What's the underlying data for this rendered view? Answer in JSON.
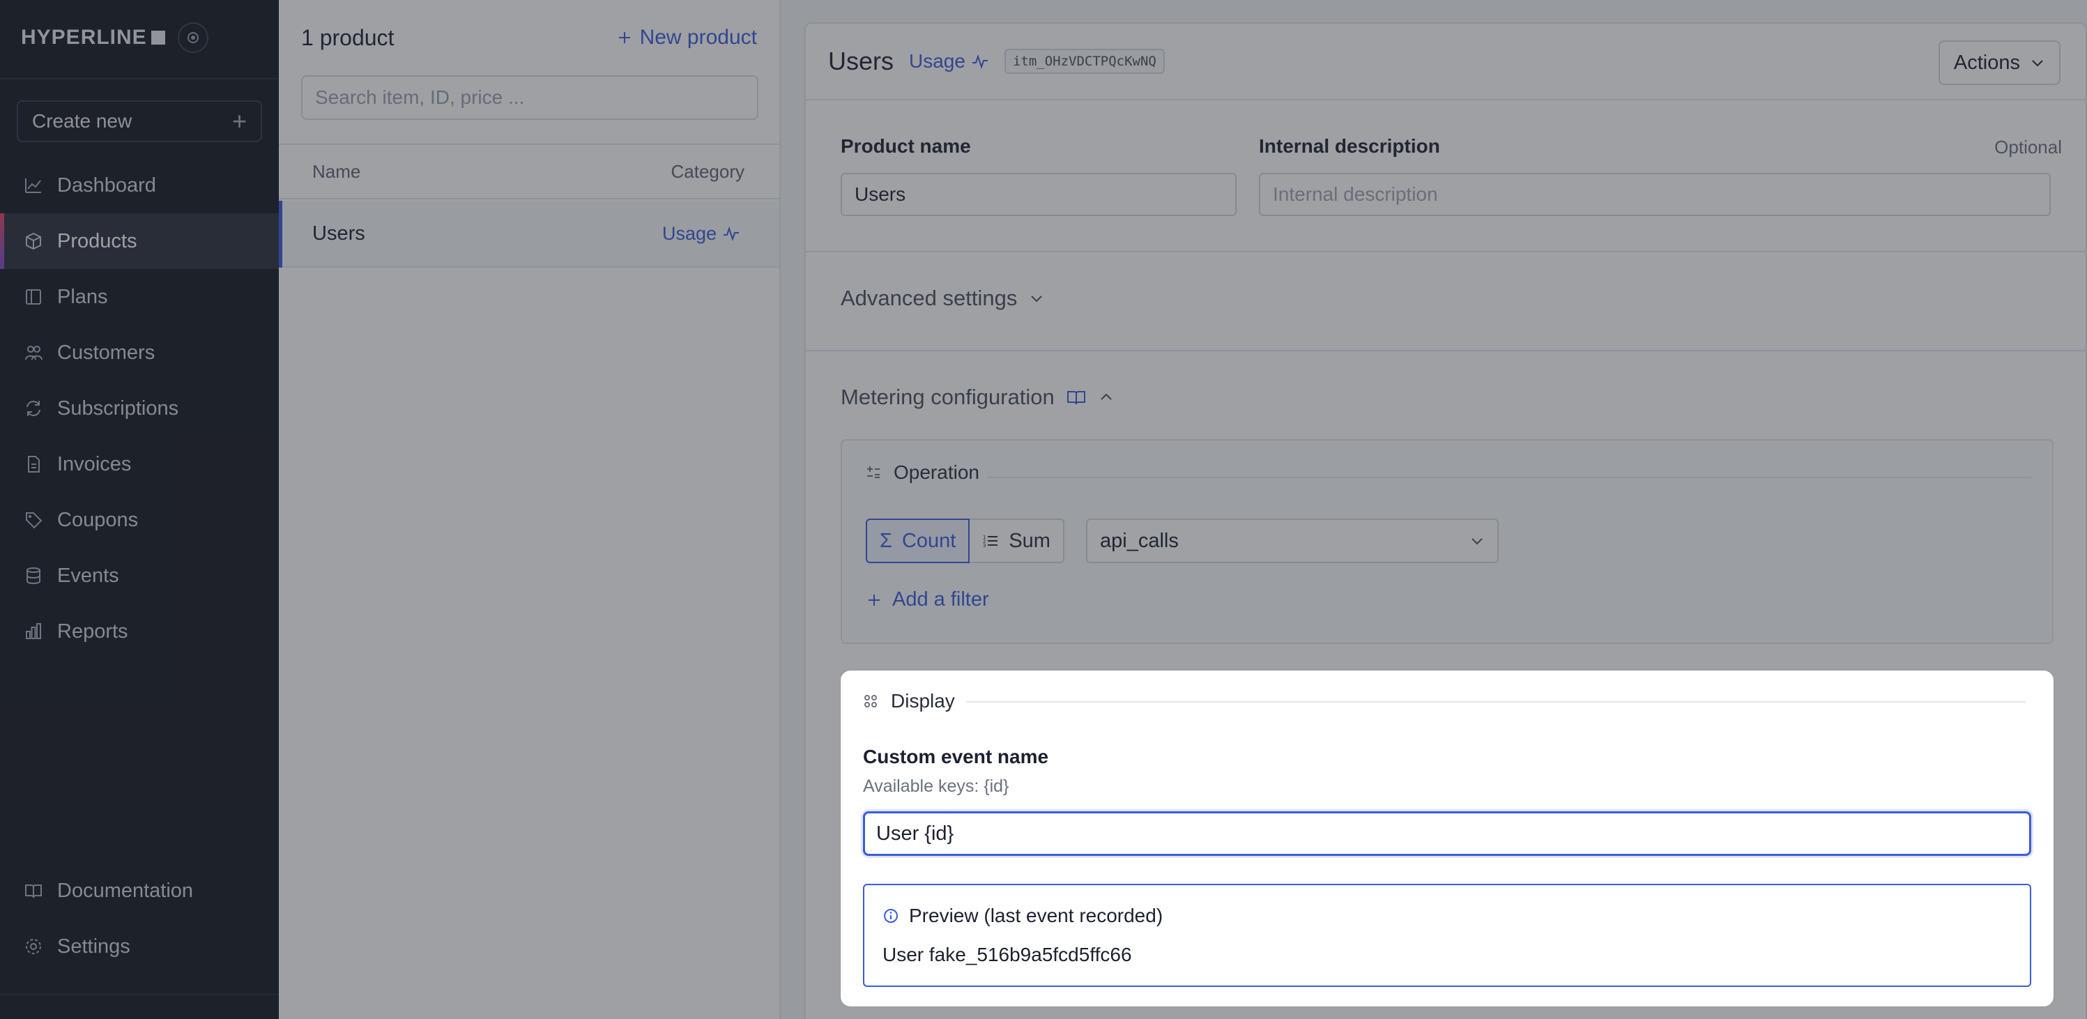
{
  "app": {
    "logo": "HYPERLINE"
  },
  "sidebar": {
    "create_new": "Create new",
    "items": [
      {
        "label": "Dashboard",
        "icon": "chart-line-icon"
      },
      {
        "label": "Products",
        "icon": "box-icon",
        "active": true
      },
      {
        "label": "Plans",
        "icon": "book-icon"
      },
      {
        "label": "Customers",
        "icon": "users-icon"
      },
      {
        "label": "Subscriptions",
        "icon": "refresh-icon"
      },
      {
        "label": "Invoices",
        "icon": "file-icon"
      },
      {
        "label": "Coupons",
        "icon": "tag-icon"
      },
      {
        "label": "Events",
        "icon": "database-icon"
      },
      {
        "label": "Reports",
        "icon": "bar-chart-icon"
      }
    ],
    "bottom_items": [
      {
        "label": "Documentation",
        "icon": "book-open-icon"
      },
      {
        "label": "Settings",
        "icon": "gear-icon"
      }
    ]
  },
  "list": {
    "count": "1 product",
    "new_product": "New product",
    "search_placeholder": "Search item, ID, price ...",
    "columns": {
      "name": "Name",
      "category": "Category"
    },
    "rows": [
      {
        "name": "Users",
        "category": "Usage"
      }
    ]
  },
  "detail": {
    "title": "Users",
    "category": "Usage",
    "item_id": "itm_OHzVDCTPQcKwNQ",
    "actions": "Actions",
    "product_name_label": "Product name",
    "product_name_value": "Users",
    "internal_description_label": "Internal description",
    "optional": "Optional",
    "internal_description_placeholder": "Internal description",
    "advanced_settings": "Advanced settings",
    "metering_configuration": "Metering configuration",
    "operation": {
      "title": "Operation",
      "count": "Count",
      "sum": "Sum",
      "selected": "Count",
      "event_select": "api_calls",
      "add_filter": "Add a filter"
    },
    "display": {
      "title": "Display",
      "custom_event_label": "Custom event name",
      "available_keys": "Available keys: {id}",
      "custom_event_value": "User {id}",
      "preview_title": "Preview (last event recorded)",
      "preview_value": "User fake_516b9a5fcd5ffc66"
    }
  },
  "colors": {
    "accent": "#3b5bdb",
    "sidebar_bg": "#151821"
  }
}
